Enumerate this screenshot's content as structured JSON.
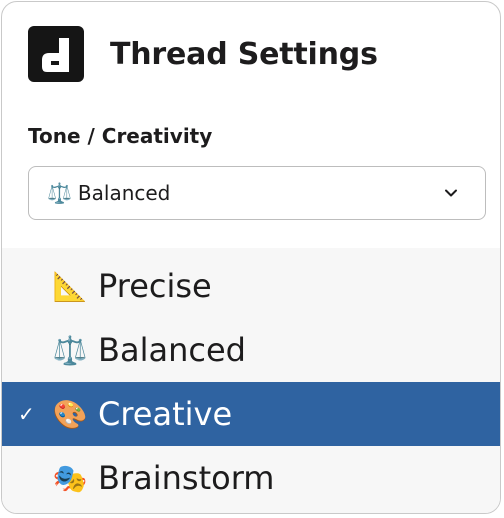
{
  "header": {
    "title": "Thread Settings",
    "logo_icon": "d-logo-icon"
  },
  "field": {
    "label": "Tone / Creativity",
    "selected_emoji": "⚖️",
    "selected_value": "Balanced",
    "chevron_icon": "chevron-down-icon"
  },
  "menu": {
    "options": [
      {
        "emoji": "📐",
        "label": "Precise"
      },
      {
        "emoji": "⚖️",
        "label": "Balanced"
      },
      {
        "emoji": "🎨",
        "label": "Creative",
        "check": "✓"
      },
      {
        "emoji": "🎭",
        "label": "Brainstorm"
      }
    ]
  },
  "colors": {
    "highlight": "#2f63a1",
    "menu_bg": "#f7f7f7",
    "logo_bg": "#151515"
  }
}
